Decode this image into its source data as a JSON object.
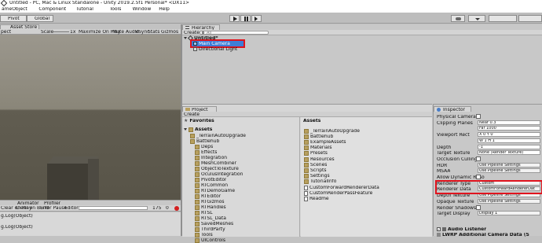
{
  "window": {
    "title": "Untitled - PC, Mac & Linux Standalone - Unity 2019.2.5f1 Personal* <DX11>"
  },
  "menu": [
    "ameObject",
    "Component",
    "Tutorial",
    "Tools",
    "Window",
    "Help"
  ],
  "toolbar": {
    "pivot": "Pivot",
    "global": "Global"
  },
  "asset_store": {
    "tab": "Asset Store"
  },
  "game": {
    "left": "pect",
    "scale_label": "Scale",
    "scale_value": "1x",
    "maximize": "Maximize On Play",
    "mute": "Mute Audio",
    "vsync": "VSync",
    "stats": "Stats",
    "gizmos": "Gizmos"
  },
  "console": {
    "tabs": [
      "Animator",
      "Profiler"
    ],
    "buttons": [
      "Clear on Play",
      "Clear on Build",
      "Error Pause",
      "Editor"
    ],
    "lines": [
      "g.Log(Object)",
      "g.Log(Object)"
    ],
    "counts": [
      "175",
      "0"
    ]
  },
  "hierarchy": {
    "tab": "Hierarchy",
    "create": "Create",
    "search": "All",
    "scene": "Untitled*",
    "items": [
      "Main Camera",
      "Directional Light"
    ]
  },
  "project": {
    "tab": "Project",
    "create": "Create",
    "favorites": "Favorites",
    "assets": "Assets",
    "tree": [
      "_TerrainAutoUpgrade",
      "Battlehub",
      "Deps",
      "Effects",
      "Integration",
      "MeshCombiner",
      "ObjectToTexture",
      "OculusIntegration",
      "PivotEditor",
      "RTCommon",
      "RTDemoGame",
      "RTEditor",
      "RTGizmos",
      "RTHandles",
      "RTSL",
      "RTSL_Data",
      "SavedMeshes",
      "ThirdParty",
      "Tools",
      "UIControls"
    ],
    "grid": [
      "_TerrainAutoUpgrade",
      "Battlehub",
      "ExampleAssets",
      "Materials",
      "Presets",
      "Resources",
      "Scenes",
      "Scripts",
      "Settings",
      "TutorialInfo",
      "CustomForwardRendererData",
      "CustomRenderPassFeature",
      "Readme"
    ]
  },
  "inspector": {
    "tab": "Inspector",
    "rows": [
      {
        "label": "Physical Camera",
        "value": ""
      },
      {
        "label": "Clipping Planes",
        "value": "Near  0.3"
      },
      {
        "label": "",
        "value": "Far   1000"
      },
      {
        "label": "Viewport Rect",
        "value": "X 0    Y 0"
      },
      {
        "label": "",
        "value": "W 1    H 1"
      },
      {
        "label": "Depth",
        "value": "-1"
      },
      {
        "label": "Target Texture",
        "value": "None (Render Texture)"
      },
      {
        "label": "Occlusion Culling",
        "value": ""
      },
      {
        "label": "HDR",
        "value": "Use Pipeline Settings"
      },
      {
        "label": "MSAA",
        "value": "Use Pipeline Settings"
      },
      {
        "label": "Allow Dynamic Reso",
        "value": ""
      },
      {
        "label": "Renderer Type",
        "value": "Custom"
      },
      {
        "label": "Renderer Data",
        "value": "CustomForwardRendererDat"
      },
      {
        "label": "Depth Texture",
        "value": "Use Pipeline Settings"
      },
      {
        "label": "Opaque Texture",
        "value": "Use Pipeline Settings"
      },
      {
        "label": "Render Shadows",
        "value": ""
      },
      {
        "label": "Target Display",
        "value": "Display 1"
      }
    ],
    "components": [
      "Audio Listener",
      "LWRP Additional Camera Data (S"
    ]
  }
}
